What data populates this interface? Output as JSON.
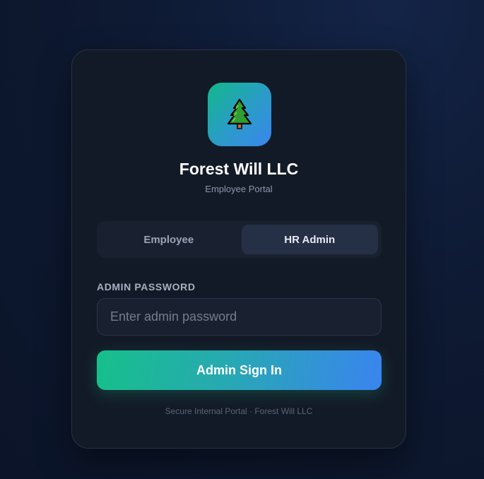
{
  "brand": {
    "logo_icon": "pine-tree-icon",
    "name": "Forest Will LLC",
    "subtitle": "Employee Portal"
  },
  "tabs": [
    {
      "label": "Employee",
      "active": false
    },
    {
      "label": "HR Admin",
      "active": true
    }
  ],
  "form": {
    "password_label": "ADMIN PASSWORD",
    "password_placeholder": "Enter admin password",
    "password_value": "",
    "submit_label": "Admin Sign In"
  },
  "footer": {
    "text": "Secure Internal Portal · Forest Will LLC"
  },
  "colors": {
    "accent_start": "#16c08a",
    "accent_end": "#3a84ef",
    "card_bg": "#131a27"
  }
}
